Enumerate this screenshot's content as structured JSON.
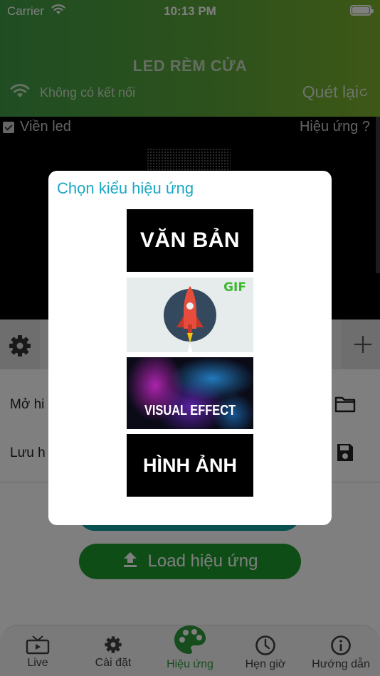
{
  "status_bar": {
    "carrier": "Carrier",
    "time": "10:13 PM"
  },
  "header": {
    "title": "LED RÈM CỬA",
    "connection_status": "Không có kết nối",
    "rescan_label": "Quét lại"
  },
  "preview": {
    "led_border_label": "Viền led",
    "led_border_checked": true,
    "effect_help_label": "Hiệu ứng ?"
  },
  "menu": {
    "open_effect_label": "Mở hi",
    "save_effect_label": "Lưu h"
  },
  "load_button_label": "Load hiệu ứng",
  "tabs": [
    {
      "label": "Live",
      "icon": "tv-icon"
    },
    {
      "label": "Cài đặt",
      "icon": "gear-icon"
    },
    {
      "label": "Hiệu ứng",
      "icon": "palette-icon",
      "active": true
    },
    {
      "label": "Hẹn giờ",
      "icon": "clock-icon"
    },
    {
      "label": "Hướng dẫn",
      "icon": "info-icon"
    }
  ],
  "modal": {
    "title": "Chọn kiểu hiệu ứng",
    "options": [
      {
        "label": "VĂN BẢN"
      },
      {
        "label": "GIF"
      },
      {
        "label": "VISUAL EFFECT"
      },
      {
        "label": "HÌNH ẢNH"
      }
    ]
  },
  "colors": {
    "header_green": "#4ea13f",
    "active_green": "#2f9a3a",
    "load_button": "#1f9a2d",
    "teal_button": "#13a0a0",
    "modal_title": "#19a7c5"
  }
}
